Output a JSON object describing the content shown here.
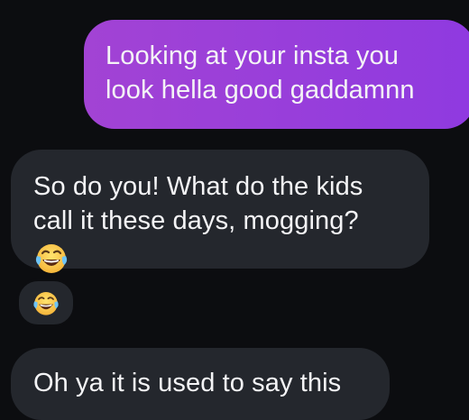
{
  "conversation": {
    "messages": [
      {
        "sender": "me",
        "lines": [
          "Looking at your insta you",
          "look hella good gaddamnn"
        ]
      },
      {
        "sender": "them",
        "lines": [
          "So do you! What do the kids",
          "call it these days, mogging?"
        ],
        "emoji": "face-with-tears-of-joy",
        "reaction": "face-with-tears-of-joy"
      },
      {
        "sender": "them",
        "lines": [
          "Oh ya it is used to say this"
        ]
      }
    ]
  },
  "colors": {
    "background": "#0c0d10",
    "sent_bubble_start": "#a243d4",
    "sent_bubble_end": "#8f3ae0",
    "received_bubble": "#24272d",
    "text": "#f4f4f6"
  }
}
